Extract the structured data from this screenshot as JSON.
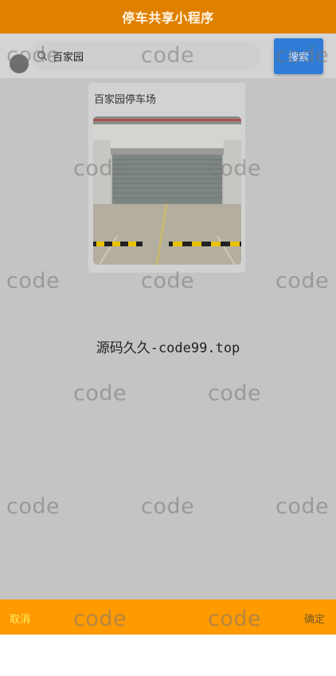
{
  "header": {
    "title": "停车共享小程序"
  },
  "search": {
    "value": "百家园",
    "button_label": "搜索"
  },
  "result": {
    "name": "百家园停车场"
  },
  "center_text": "源码久久-code99.top",
  "bottom": {
    "cancel_label": "取消",
    "confirm_label": "确定"
  },
  "watermark": {
    "text": "code"
  },
  "colors": {
    "header": "#e08000",
    "bottom_bar": "#ff9a00",
    "search_button": "#2e7cd6",
    "cancel_text": "#ffee66"
  }
}
